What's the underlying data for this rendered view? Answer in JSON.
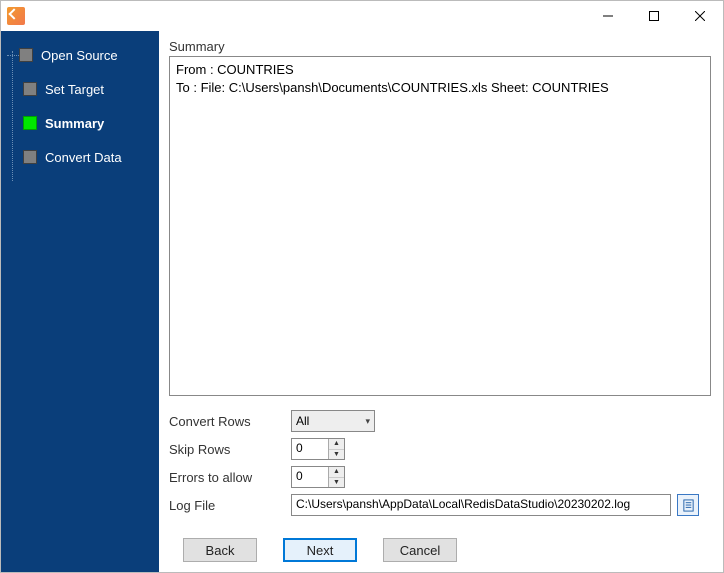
{
  "sidebar": {
    "items": [
      {
        "label": "Open Source",
        "active": false
      },
      {
        "label": "Set Target",
        "active": false
      },
      {
        "label": "Summary",
        "active": true
      },
      {
        "label": "Convert Data",
        "active": false
      }
    ]
  },
  "main": {
    "section_title": "Summary",
    "summary_text": "From : COUNTRIES\nTo : File: C:\\Users\\pansh\\Documents\\COUNTRIES.xls Sheet: COUNTRIES",
    "fields": {
      "convert_rows_label": "Convert Rows",
      "convert_rows_value": "All",
      "skip_rows_label": "Skip Rows",
      "skip_rows_value": "0",
      "errors_label": "Errors to allow",
      "errors_value": "0",
      "log_file_label": "Log File",
      "log_file_value": "C:\\Users\\pansh\\AppData\\Local\\RedisDataStudio\\20230202.log"
    }
  },
  "buttons": {
    "back": "Back",
    "next": "Next",
    "cancel": "Cancel"
  }
}
